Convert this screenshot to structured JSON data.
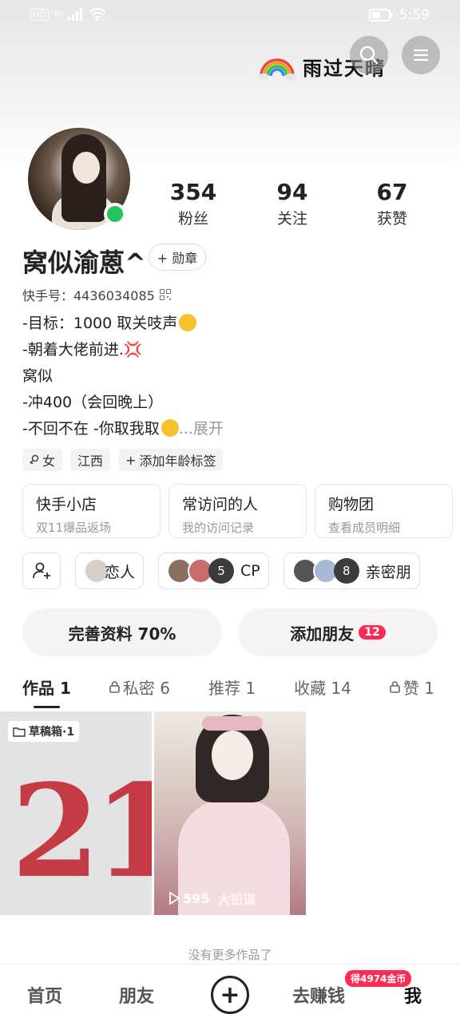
{
  "status_bar": {
    "hd": "HD",
    "signal": "4G",
    "time": "5:59"
  },
  "banner": {
    "text": "雨过天晴"
  },
  "profile": {
    "name": "窝似渝蒽^",
    "badge_label": "+ 勋章",
    "kuaishou_id": "快手号：4436034085",
    "stats": [
      {
        "value": "354",
        "label": "粉丝"
      },
      {
        "value": "94",
        "label": "关注"
      },
      {
        "value": "67",
        "label": "获赞"
      }
    ],
    "bio": {
      "line1": "-目标：1000  取关吱声",
      "line2": "-朝着大佬前进.",
      "line2_emoji": "💢",
      "line3": "窝似",
      "line4": "-冲400（会回晚上）",
      "line5": "-不回不在 -你取我取",
      "expand": "...展开"
    },
    "tags": [
      "女",
      "江西",
      "添加年龄标签"
    ]
  },
  "quick_boxes": [
    {
      "title": "快手小店",
      "subtitle": "双11爆品返场"
    },
    {
      "title": "常访问的人",
      "subtitle": "我的访问记录"
    },
    {
      "title": "购物团",
      "subtitle": "查看成员明细"
    }
  ],
  "relations": [
    {
      "label": "恋人"
    },
    {
      "label": "CP",
      "extra_count": "5"
    },
    {
      "label": "亲密朋",
      "extra_count": "8"
    }
  ],
  "actions": {
    "complete_profile": "完善资料 70%",
    "add_friend": "添加朋友",
    "add_friend_count": "12"
  },
  "tabs": [
    {
      "label": "作品 1",
      "locked": false
    },
    {
      "label": "私密 6",
      "locked": true
    },
    {
      "label": "推荐 1",
      "locked": false
    },
    {
      "label": "收藏 14",
      "locked": false
    },
    {
      "label": "赞 1",
      "locked": true
    }
  ],
  "works": {
    "draft_label": "草稿箱·1",
    "draft_number": "21",
    "video_plays": "595",
    "video_tag": "大铅道"
  },
  "no_more": "没有更多作品了",
  "bottom_nav": {
    "home": "首页",
    "friends": "朋友",
    "earn": "去赚钱",
    "earn_badge": "得4974金币",
    "me": "我"
  }
}
